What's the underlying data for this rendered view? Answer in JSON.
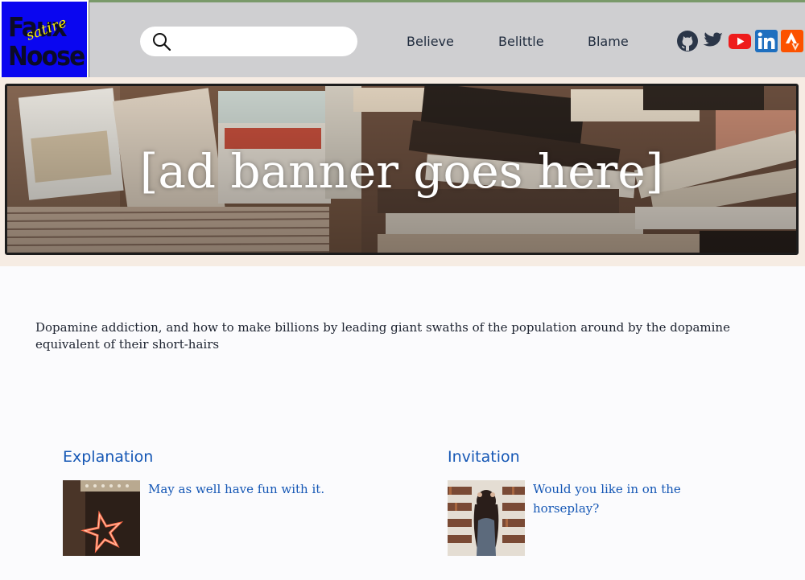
{
  "logo": {
    "line1": "Faux",
    "line2": "Noose",
    "tag": "satire",
    "bg_color": "#0a06f0",
    "tag_color": "#f6f000"
  },
  "search": {
    "placeholder": "",
    "value": "",
    "icon": "search-icon"
  },
  "nav": {
    "items": [
      {
        "label": "Believe"
      },
      {
        "label": "Belittle"
      },
      {
        "label": "Blame"
      }
    ]
  },
  "social": [
    {
      "icon": "github-icon",
      "color": "#2b3648"
    },
    {
      "icon": "twitter-icon",
      "color": "#2b3648"
    },
    {
      "icon": "youtube-icon",
      "color": "#ee1c1c"
    },
    {
      "icon": "linkedin-icon",
      "color": "#1e6fbf"
    },
    {
      "icon": "strava-icon",
      "color": "#fc5200"
    }
  ],
  "banner": {
    "text": "[ad banner goes here]"
  },
  "intro": "Dopamine addiction, and how to make billions by leading giant swaths of the population around by the dopamine equivalent of their short-hairs",
  "cards": [
    {
      "heading": "Explanation",
      "text": "May as well have fun with it.",
      "thumb": "neon-star-image"
    },
    {
      "heading": "Invitation",
      "text": "Would you like in on the horseplay?",
      "thumb": "woman-in-library-image"
    }
  ],
  "colors": {
    "header_bg": "#cfcfd1",
    "link": "#1557b5",
    "banner_band": "#f6ece3"
  }
}
